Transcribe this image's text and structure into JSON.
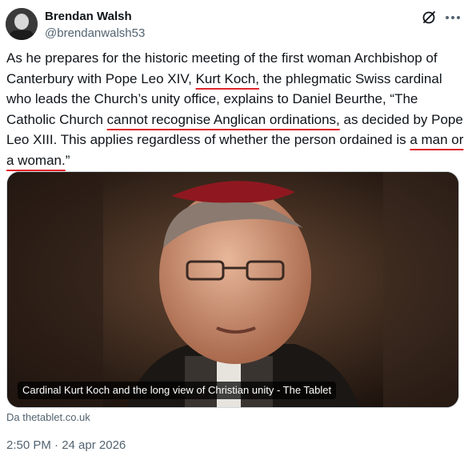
{
  "author": {
    "name": "Brendan Walsh",
    "handle": "@brendanwalsh53",
    "avatar_icon": "avatar-photo"
  },
  "actions": {
    "grok_icon": "grok-icon",
    "more_icon": "more-icon"
  },
  "tweet": {
    "segments": [
      {
        "text": "As he prepares for the historic meeting of the first woman Archbishop of Canterbury with Pope Leo XIV, ",
        "highlight": false
      },
      {
        "text": "Kurt Koch,",
        "highlight": true
      },
      {
        "text": " the phlegmatic Swiss cardinal who leads the Church’s unity office, explains to Daniel Beurthe, “The Catholic Church ",
        "highlight": false
      },
      {
        "text": "cannot recognise Anglican ordinations,",
        "highlight": true
      },
      {
        "text": " as decided by Pope Leo XIII. This applies regardless of whether the person ordained is ",
        "highlight": false
      },
      {
        "text": "a man or a woman.",
        "highlight": true
      },
      {
        "text": "”",
        "highlight": false
      }
    ],
    "highlight_color": "#e0252b"
  },
  "card": {
    "caption": "Cardinal Kurt Koch and the long view of Christian unity - The Tablet",
    "domain": "Da thetablet.co.uk"
  },
  "timestamp": "2:50 PM · 24 apr 2026",
  "colors": {
    "text": "#0f1419",
    "secondary": "#536471",
    "border": "#cfd9de"
  }
}
